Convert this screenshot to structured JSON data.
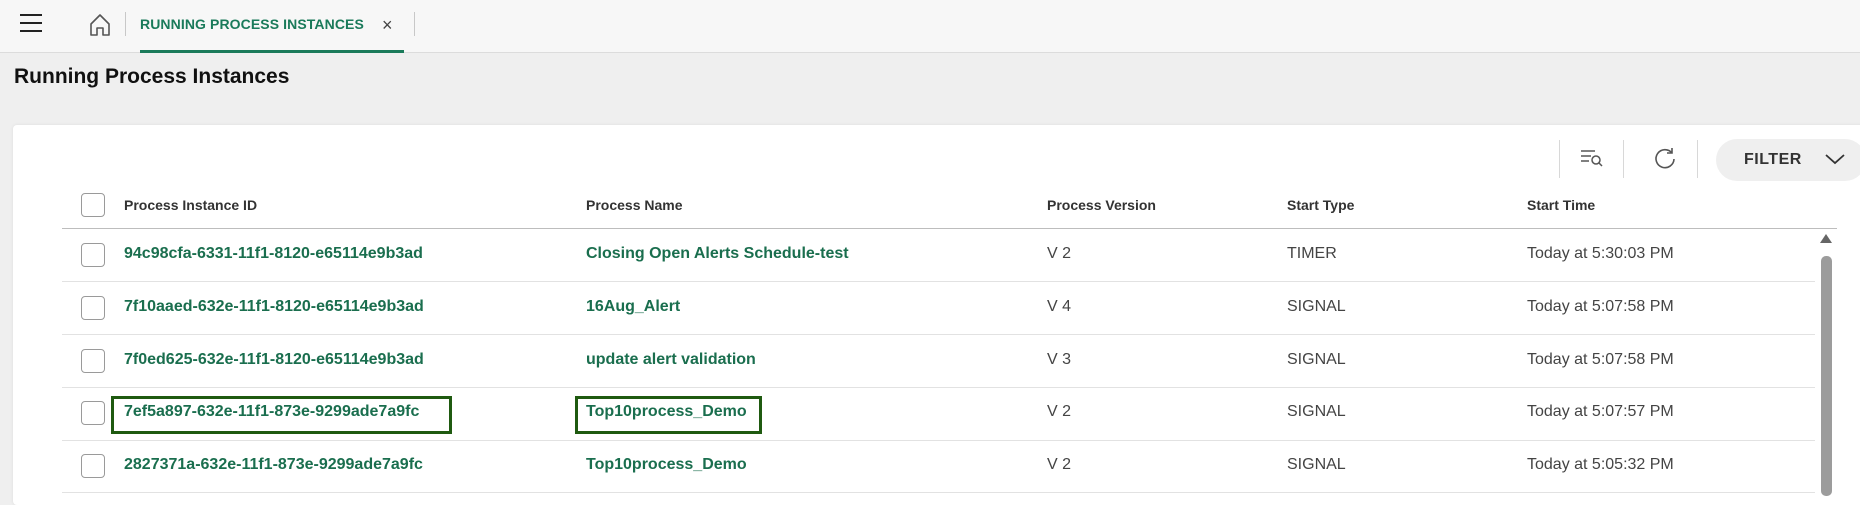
{
  "nav": {
    "menu_icon": "hamburger-menu-icon",
    "home_icon": "home-icon",
    "tab": {
      "label": "RUNNING PROCESS INSTANCES",
      "close_glyph": "×"
    }
  },
  "page": {
    "title": "Running Process Instances"
  },
  "toolbar": {
    "search_list_icon": "search-list-icon",
    "refresh_icon": "refresh-icon",
    "filter_label": "FILTER",
    "filter_icon": "chevron-down-icon"
  },
  "table": {
    "columns": [
      "Process Instance ID",
      "Process Name",
      "Process Version",
      "Start Type",
      "Start Time"
    ],
    "rows": [
      {
        "id": "94c98cfa-6331-11f1-8120-e65114e9b3ad",
        "name": "Closing Open Alerts Schedule-test",
        "version": "V 2",
        "start_type": "TIMER",
        "start_time": "Today at 5:30:03 PM"
      },
      {
        "id": "7f10aaed-632e-11f1-8120-e65114e9b3ad",
        "name": "16Aug_Alert",
        "version": "V 4",
        "start_type": "SIGNAL",
        "start_time": "Today at 5:07:58 PM"
      },
      {
        "id": "7f0ed625-632e-11f1-8120-e65114e9b3ad",
        "name": "update alert validation",
        "version": "V 3",
        "start_type": "SIGNAL",
        "start_time": "Today at 5:07:58 PM"
      },
      {
        "id": "7ef5a897-632e-11f1-873e-9299ade7a9fc",
        "name": "Top10process_Demo",
        "version": "V 2",
        "start_type": "SIGNAL",
        "start_time": "Today at 5:07:57 PM"
      },
      {
        "id": "2827371a-632e-11f1-873e-9299ade7a9fc",
        "name": "Top10process_Demo",
        "version": "V 2",
        "start_type": "SIGNAL",
        "start_time": "Today at 5:05:32 PM"
      }
    ]
  },
  "colors": {
    "accent": "#1a7a5a",
    "link": "#1a6e4e",
    "highlight_border": "#1f5a10"
  }
}
